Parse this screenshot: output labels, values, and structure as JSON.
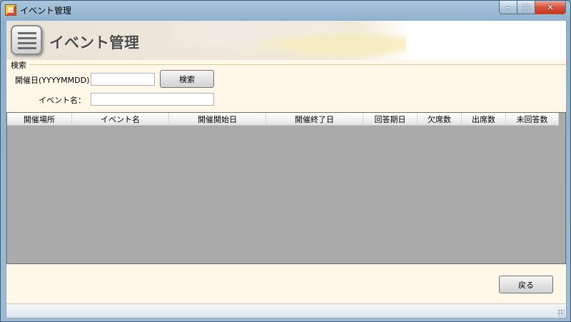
{
  "window": {
    "title": "イベント管理",
    "minimize": "–",
    "maximize": "□",
    "close": "✕"
  },
  "banner": {
    "title": "イベント管理"
  },
  "search": {
    "group_label": "検索",
    "date_label": "開催日(YYYYMMDD)：",
    "date_value": "",
    "name_label": "イベント名：",
    "name_value": "",
    "search_button": "検索"
  },
  "grid": {
    "columns": [
      "開催場所",
      "イベント名",
      "開催開始日",
      "開催終了日",
      "回答期日",
      "欠席数",
      "出席数",
      "未回答数"
    ],
    "rows": []
  },
  "footer": {
    "back_button": "戻る"
  },
  "colors": {
    "panel_bg": "#fff7e8",
    "grid_bg": "#aaaaaa",
    "title_text": "#4d4d4d"
  }
}
